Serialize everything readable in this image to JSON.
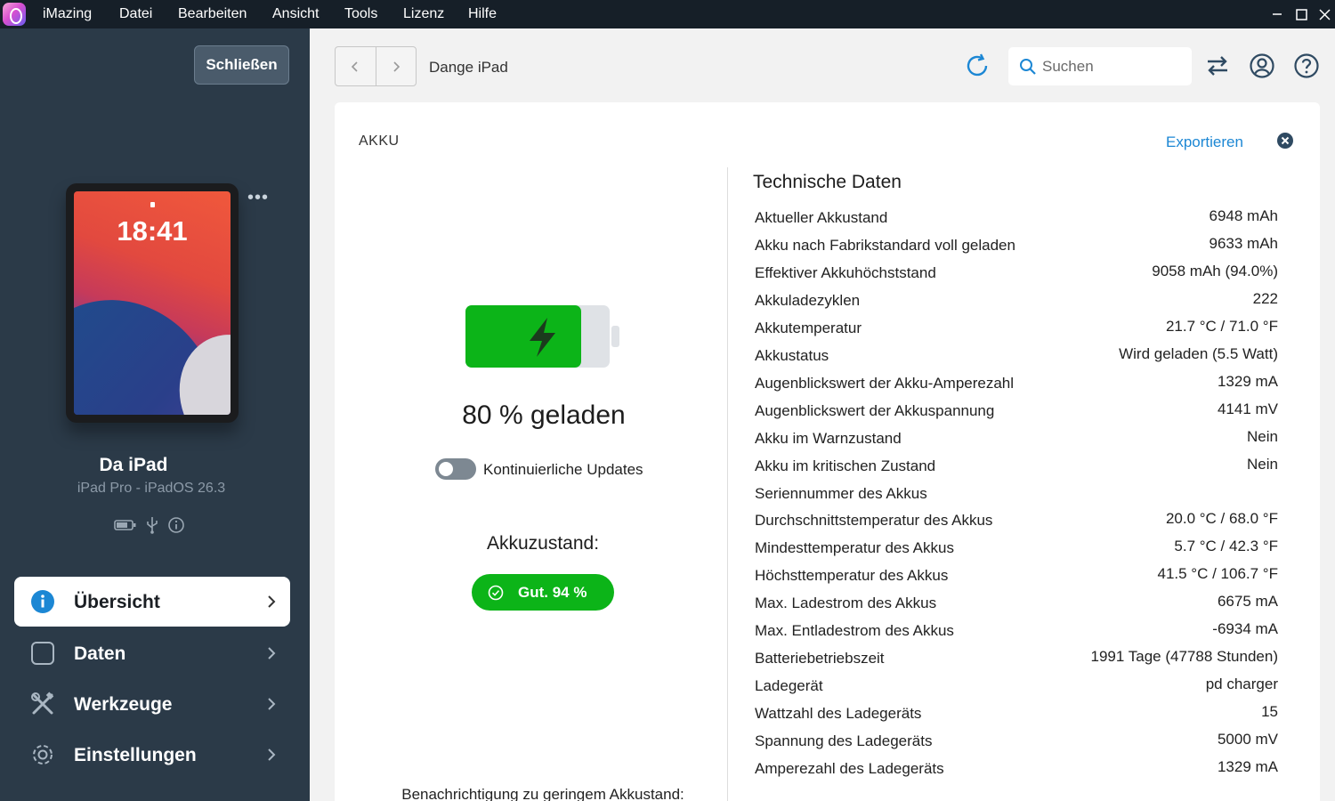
{
  "menubar": {
    "items": [
      "iMazing",
      "Datei",
      "Bearbeiten",
      "Ansicht",
      "Tools",
      "Lizenz",
      "Hilfe"
    ]
  },
  "sidebar": {
    "close_label": "Schließen",
    "device_time": "18:41",
    "device_name": "Da iPad",
    "device_model": "iPad Pro - iPadOS 26.3",
    "nav": [
      {
        "label": "Übersicht",
        "icon": "info-icon"
      },
      {
        "label": "Daten",
        "icon": "square-icon"
      },
      {
        "label": "Werkzeuge",
        "icon": "tools-icon"
      },
      {
        "label": "Einstellungen",
        "icon": "gear-icon"
      }
    ]
  },
  "toolbar": {
    "breadcrumb": "Dange iPad",
    "search_placeholder": "Suchen"
  },
  "panel": {
    "title": "AKKU",
    "export_label": "Exportieren",
    "charge_text": "80 % geladen",
    "charge_level": 0.8,
    "toggle_label": "Kontinuierliche Updates",
    "health_label": "Akkuzustand:",
    "health_badge": "Gut. 94 %",
    "low_battery_label": "Benachrichtigung zu geringem Akkustand:",
    "accent_green": "#0cb418",
    "accent_blue": "#1c87d4"
  },
  "specs": {
    "title": "Technische Daten",
    "rows": [
      {
        "key": "Aktueller Akkustand",
        "value": "6948 mAh"
      },
      {
        "key": "Akku nach Fabrikstandard voll geladen",
        "value": "9633 mAh"
      },
      {
        "key": "Effektiver Akkuhöchststand",
        "value": "9058 mAh (94.0%)"
      },
      {
        "key": "Akkuladezyklen",
        "value": "222"
      },
      {
        "key": "Akkutemperatur",
        "value": "21.7 °C / 71.0 °F"
      },
      {
        "key": "Akkustatus",
        "value": "Wird geladen (5.5 Watt)"
      },
      {
        "key": "Augenblickswert der Akku-Amperezahl",
        "value": "1329 mA"
      },
      {
        "key": "Augenblickswert der Akkuspannung",
        "value": "4141 mV"
      },
      {
        "key": "Akku im Warnzustand",
        "value": "Nein"
      },
      {
        "key": "Akku im kritischen Zustand",
        "value": "Nein"
      },
      {
        "key": "Seriennummer des Akkus",
        "value": ""
      },
      {
        "key": "Durchschnittstemperatur des Akkus",
        "value": "20.0 °C / 68.0 °F"
      },
      {
        "key": "Mindesttemperatur des Akkus",
        "value": "5.7 °C / 42.3 °F"
      },
      {
        "key": "Höchsttemperatur des Akkus",
        "value": "41.5 °C / 106.7 °F"
      },
      {
        "key": "Max. Ladestrom des Akkus",
        "value": "6675 mA"
      },
      {
        "key": "Max. Entladestrom des Akkus",
        "value": "-6934 mA"
      },
      {
        "key": "Batteriebetriebszeit",
        "value": "1991 Tage (47788 Stunden)"
      },
      {
        "key": "Ladegerät",
        "value": "pd charger"
      },
      {
        "key": "Wattzahl des Ladegeräts",
        "value": "15"
      },
      {
        "key": "Spannung des Ladegeräts",
        "value": "5000 mV"
      },
      {
        "key": "Amperezahl des Ladegeräts",
        "value": "1329 mA"
      }
    ]
  }
}
